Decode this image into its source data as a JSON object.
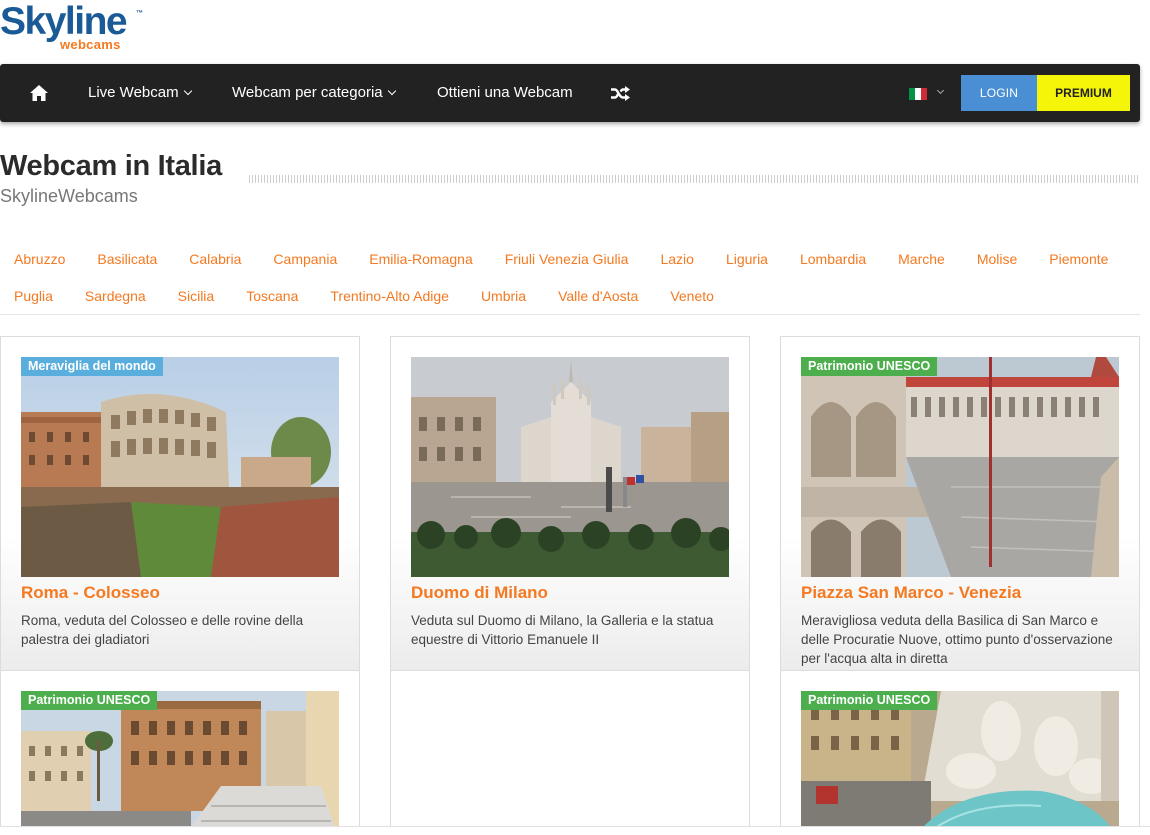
{
  "logo": {
    "main": "Skyline",
    "tm": "™",
    "sub": "webcams"
  },
  "nav": {
    "home_icon": "home-icon",
    "items": [
      {
        "label": "Live Webcam",
        "dropdown": true
      },
      {
        "label": "Webcam per categoria",
        "dropdown": true
      },
      {
        "label": "Ottieni una Webcam",
        "dropdown": false
      }
    ],
    "shuffle_icon": "shuffle-icon",
    "language_flag": [
      "#009246",
      "#ffffff",
      "#ce2b37"
    ],
    "login_label": "LOGIN",
    "premium_label": "PREMIUM"
  },
  "page": {
    "title": "Webcam in Italia",
    "subtitle": "SkylineWebcams"
  },
  "regions": {
    "row1": [
      "Abruzzo",
      "Basilicata",
      "Calabria",
      "Campania",
      "Emilia-Romagna",
      "Friuli Venezia Giulia",
      "Lazio",
      "Liguria",
      "Lombardia",
      "Marche",
      "Molise",
      "Piemonte"
    ],
    "row2": [
      "Puglia",
      "Sardegna",
      "Sicilia",
      "Toscana",
      "Trentino-Alto Adige",
      "Umbria",
      "Valle d'Aosta",
      "Veneto"
    ]
  },
  "cards": [
    {
      "badge": "Meraviglia del mondo",
      "badge_color": "#5aaedd",
      "title": "Roma - Colosseo",
      "desc": "Roma, veduta del Colosseo e delle rovine della palestra dei gladiatori"
    },
    {
      "badge": "",
      "title": "Duomo di Milano",
      "desc": "Veduta sul Duomo di Milano, la Galleria e la statua equestre di Vittorio Emanuele II"
    },
    {
      "badge": "Patrimonio UNESCO",
      "badge_color": "#4cae4c",
      "title": "Piazza San Marco - Venezia",
      "desc": "Meravigliosa veduta della Basilica di San Marco e delle Procuratie Nuove, ottimo punto d'osservazione per l'acqua alta in diretta"
    },
    {
      "badge": "Patrimonio UNESCO",
      "badge_color": "#4cae4c"
    },
    {
      "badge": "Patrimonio UNESCO",
      "badge_color": "#4cae4c"
    }
  ]
}
